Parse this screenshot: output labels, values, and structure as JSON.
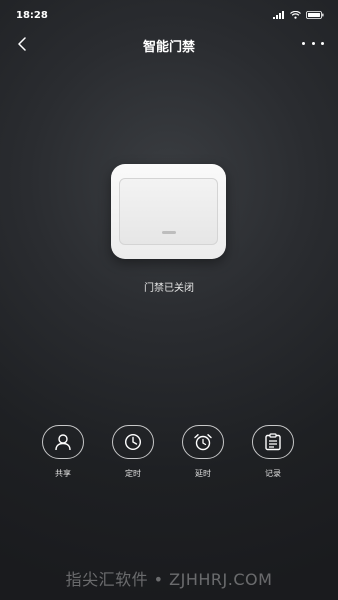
{
  "status_bar": {
    "time": "18:28"
  },
  "nav": {
    "title": "智能门禁"
  },
  "device": {
    "status_text": "门禁已关闭"
  },
  "actions": [
    {
      "label": "共享",
      "icon": "user-icon"
    },
    {
      "label": "定时",
      "icon": "clock-icon"
    },
    {
      "label": "延时",
      "icon": "alarm-clock-icon"
    },
    {
      "label": "记录",
      "icon": "record-list-icon"
    }
  ],
  "watermark": "指尖汇软件 • ZJHHRJ.COM",
  "colors": {
    "background": "#2a2c30",
    "switch": "#f3f3f3",
    "text": "#ffffff"
  }
}
